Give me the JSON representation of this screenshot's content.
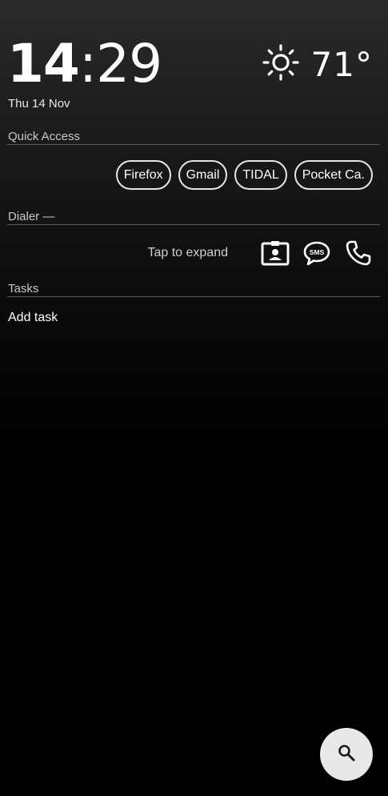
{
  "clock": {
    "hours": "14",
    "separator": ":",
    "minutes": "29",
    "date": "Thu 14 Nov"
  },
  "weather": {
    "icon": "sun-icon",
    "temperature": "71°"
  },
  "quick_access": {
    "label": "Quick Access",
    "apps": [
      "Firefox",
      "Gmail",
      "TIDAL",
      "Pocket Ca."
    ]
  },
  "dialer": {
    "label": "Dialer —",
    "hint": "Tap to expand",
    "icons": [
      "contact-card-icon",
      "sms-icon",
      "phone-icon"
    ],
    "sms_text": "SMS"
  },
  "tasks": {
    "label": "Tasks",
    "add_task": "Add task"
  },
  "search": {
    "icon": "search-icon"
  },
  "colors": {
    "fab_background": "#e8e8e8",
    "divider": "#5a5a5a",
    "chip_border": "#e6e6e6"
  }
}
